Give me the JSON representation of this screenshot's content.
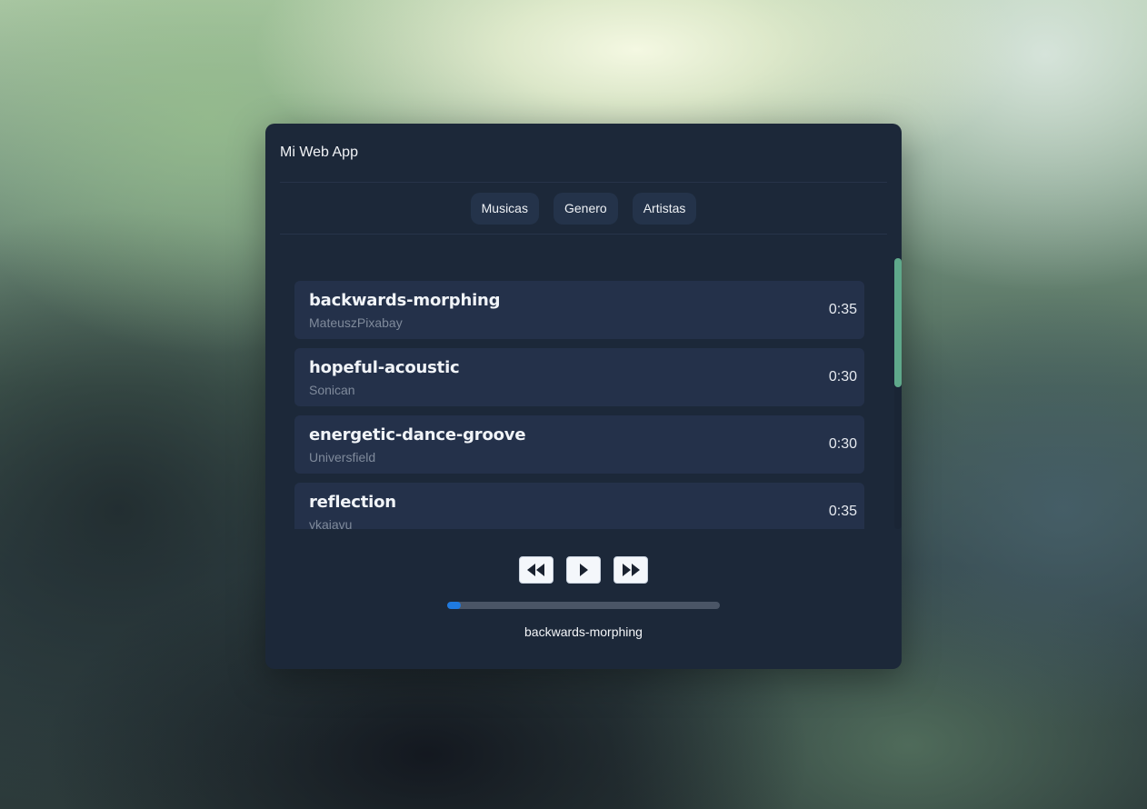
{
  "app": {
    "title": "Mi Web App"
  },
  "tabs": [
    {
      "label": "Musicas"
    },
    {
      "label": "Genero"
    },
    {
      "label": "Artistas"
    }
  ],
  "songs": [
    {
      "title": "backwards-morphing",
      "artist": "MateuszPixabay",
      "duration": "0:35"
    },
    {
      "title": "hopeful-acoustic",
      "artist": "Sonican",
      "duration": "0:30"
    },
    {
      "title": "energetic-dance-groove",
      "artist": "Universfield",
      "duration": "0:30"
    },
    {
      "title": "reflection",
      "artist": "ykaiavu",
      "duration": "0:35"
    }
  ],
  "player": {
    "buttons": [
      {
        "icon": "rewind-icon"
      },
      {
        "icon": "play-icon"
      },
      {
        "icon": "fast-forward-icon"
      }
    ],
    "progress_fraction": 0.05,
    "now_playing": "backwards-morphing"
  },
  "colors": {
    "panel": "#1c2839",
    "card": "#24314a",
    "accent_progress": "#1f7ae0",
    "scroll_thumb": "#5fa98b"
  }
}
